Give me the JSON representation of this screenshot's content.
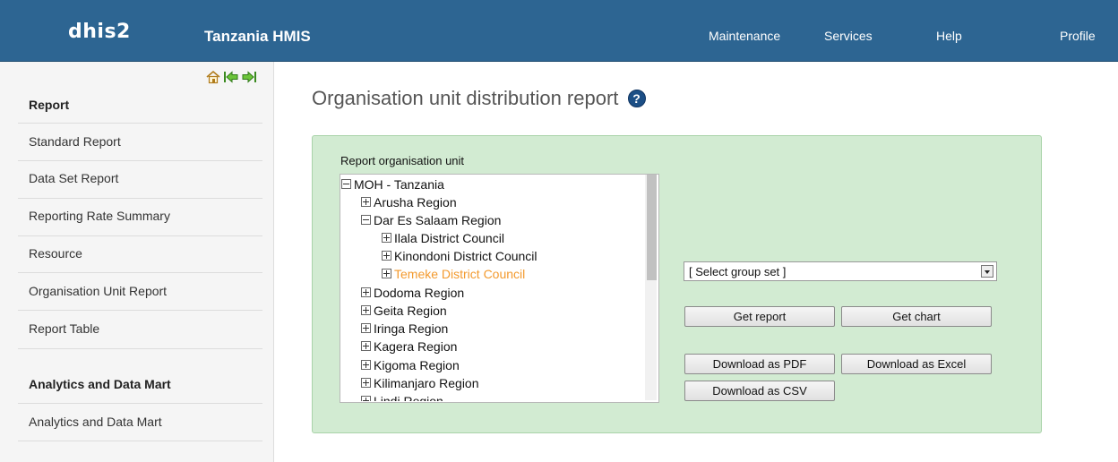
{
  "header": {
    "logo": "dhis2",
    "app_title": "Tanzania HMIS",
    "menu": [
      "Maintenance",
      "Services",
      "Help",
      "Profile"
    ]
  },
  "sidebar": {
    "sections": [
      {
        "title": "Report",
        "items": [
          "Standard Report",
          "Data Set Report",
          "Reporting Rate Summary",
          "Resource",
          "Organisation Unit Report",
          "Report Table"
        ]
      },
      {
        "title": "Analytics and Data Mart",
        "items": [
          "Analytics and Data Mart"
        ]
      }
    ],
    "nav_icons": [
      "home-icon",
      "arrow-left-icon",
      "arrow-right-icon"
    ]
  },
  "main": {
    "title": "Organisation unit distribution report",
    "help_icon": "?",
    "org_unit_label": "Report organisation unit",
    "tree": [
      {
        "label": "MOH - Tanzania",
        "expanded": true
      },
      {
        "label": "Arusha Region",
        "expanded": false
      },
      {
        "label": "Dar Es Salaam Region",
        "expanded": true
      },
      {
        "label": "Ilala District Council",
        "expanded": false
      },
      {
        "label": "Kinondoni District Council",
        "expanded": false
      },
      {
        "label": "Temeke District Council",
        "expanded": false,
        "selected": true
      },
      {
        "label": "Dodoma Region",
        "expanded": false
      },
      {
        "label": "Geita Region",
        "expanded": false
      },
      {
        "label": "Iringa Region",
        "expanded": false
      },
      {
        "label": "Kagera Region",
        "expanded": false
      },
      {
        "label": "Kigoma Region",
        "expanded": false
      },
      {
        "label": "Kilimanjaro Region",
        "expanded": false
      },
      {
        "label": "Lindi Region",
        "expanded": false
      }
    ],
    "group_set_select": "[ Select group set ]",
    "buttons": {
      "get_report": "Get report",
      "get_chart": "Get chart",
      "download_pdf": "Download as PDF",
      "download_excel": "Download as Excel",
      "download_csv": "Download as CSV"
    }
  },
  "colors": {
    "header_bg": "#2d6592",
    "panel_bg": "#d2ebd2",
    "selected_node": "#f39a2e"
  }
}
